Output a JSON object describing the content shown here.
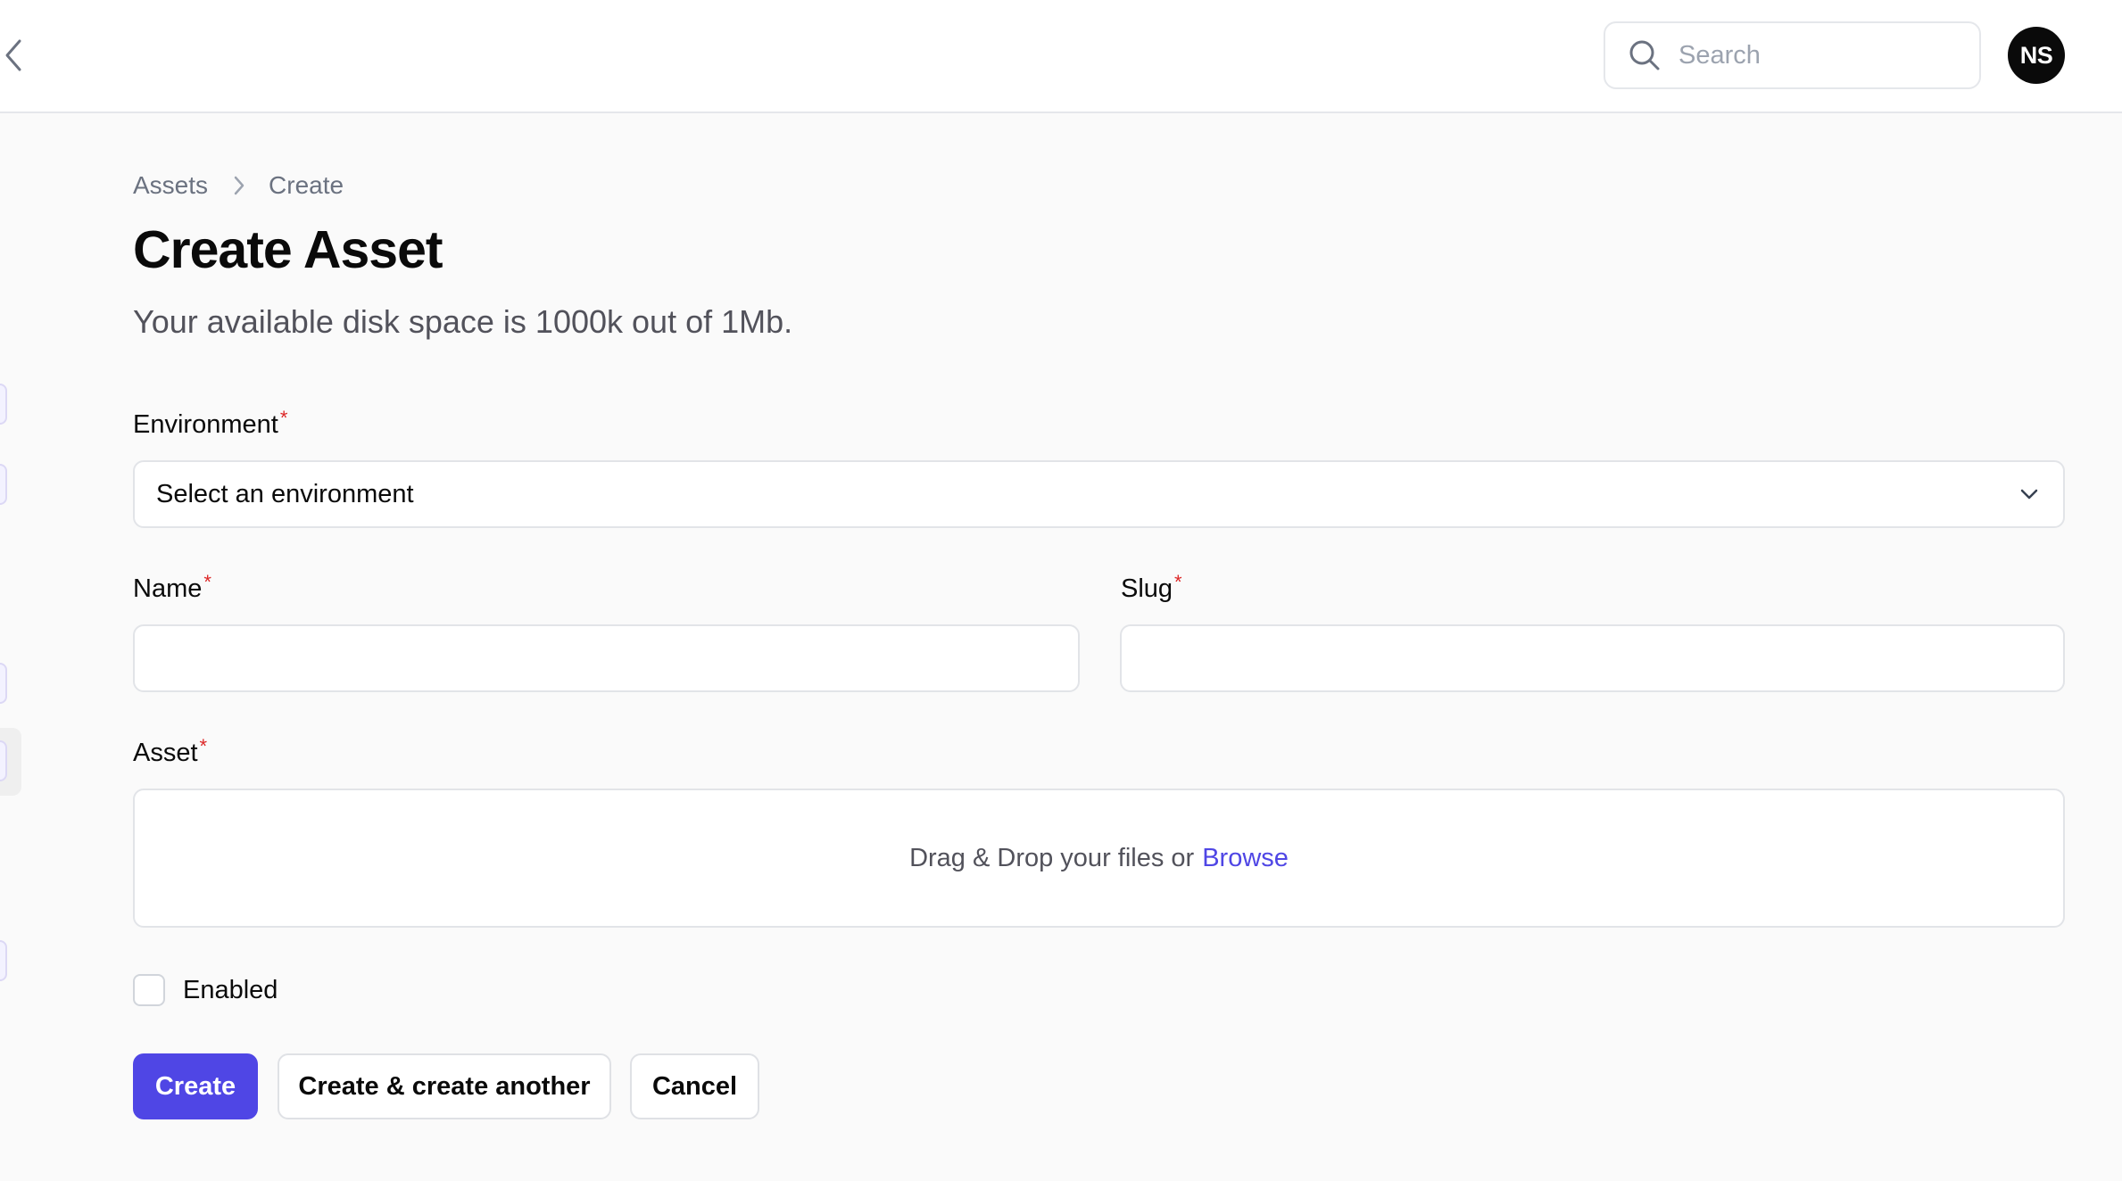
{
  "header": {
    "search_placeholder": "Search",
    "avatar_initials": "NS"
  },
  "breadcrumb": {
    "items": [
      "Assets",
      "Create"
    ]
  },
  "page": {
    "title": "Create Asset",
    "subtitle": "Your available disk space is 1000k out of 1Mb."
  },
  "form": {
    "environment": {
      "label": "Environment",
      "required_mark": "*",
      "selected": "Select an environment"
    },
    "name": {
      "label": "Name",
      "required_mark": "*",
      "value": ""
    },
    "slug": {
      "label": "Slug",
      "required_mark": "*",
      "value": ""
    },
    "asset": {
      "label": "Asset",
      "required_mark": "*",
      "drop_text": "Drag & Drop your files or",
      "browse_label": "Browse"
    },
    "enabled": {
      "label": "Enabled",
      "checked": false
    }
  },
  "actions": {
    "create": "Create",
    "create_another": "Create & create another",
    "cancel": "Cancel"
  },
  "colors": {
    "primary": "#4f46e5",
    "required": "#dc2626"
  }
}
